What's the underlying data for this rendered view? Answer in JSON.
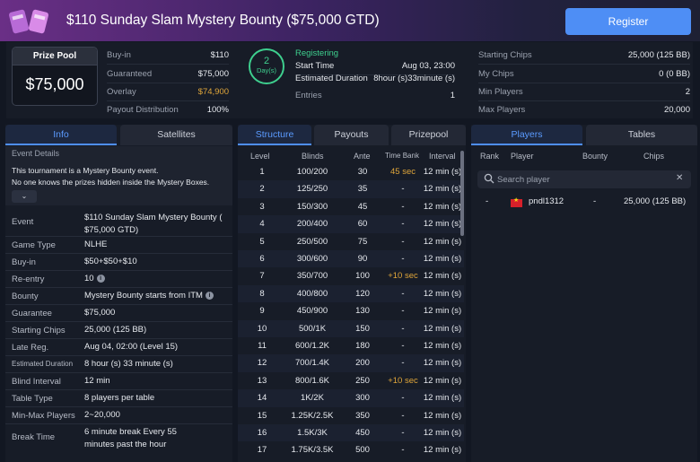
{
  "header": {
    "title": "$110 Sunday Slam Mystery Bounty ($75,000 GTD)",
    "register_label": "Register"
  },
  "summary": {
    "prize_pool_label": "Prize Pool",
    "prize_pool_value": "$75,000",
    "left": [
      {
        "label": "Buy-in",
        "value": "$110"
      },
      {
        "label": "Guaranteed",
        "value": "$75,000"
      },
      {
        "label": "Overlay",
        "value": "$74,900"
      },
      {
        "label": "Payout Distribution",
        "value": "100%"
      }
    ],
    "days_number": "2",
    "days_unit": "Day(s)",
    "status": "Registering",
    "middle": [
      {
        "label": "Start Time",
        "value": "Aug 03, 23:00"
      },
      {
        "label": "Estimated Duration",
        "value": "8hour (s)33minute (s)"
      },
      {
        "label": "Entries",
        "value": "1"
      }
    ],
    "right": [
      {
        "label": "Starting Chips",
        "value": "25,000 (125 BB)"
      },
      {
        "label": "My Chips",
        "value": "0 (0 BB)"
      },
      {
        "label": "Min Players",
        "value": "2"
      },
      {
        "label": "Max Players",
        "value": "20,000"
      }
    ]
  },
  "info_panel": {
    "tabs": [
      "Info",
      "Satellites"
    ],
    "event_details_title": "Event Details",
    "event_details_text": [
      "This tournament is a Mystery Bounty event.",
      "No one knows the prizes hidden inside the Mystery Boxes."
    ],
    "rows": [
      {
        "label": "Event",
        "value": "$110 Sunday Slam Mystery Bounty ( $75,000 GTD)"
      },
      {
        "label": "Game Type",
        "value": "NLHE"
      },
      {
        "label": "Buy-in",
        "value": "$50+$50+$10"
      },
      {
        "label": "Re-entry",
        "value": "10"
      },
      {
        "label": "Bounty",
        "value": "Mystery Bounty starts from ITM"
      },
      {
        "label": "Guarantee",
        "value": "$75,000"
      },
      {
        "label": "Starting Chips",
        "value": "25,000 (125 BB)"
      },
      {
        "label": "Late Reg.",
        "value": "Aug 04, 02:00 (Level 15)"
      },
      {
        "label": "Estimated Duration",
        "value": "8 hour (s) 33 minute (s)"
      },
      {
        "label": "Blind Interval",
        "value": "12 min"
      },
      {
        "label": "Table Type",
        "value": "8 players per table"
      },
      {
        "label": "Min-Max Players",
        "value": "2~20,000"
      },
      {
        "label": "Break Time",
        "value": "6 minute break Every 55 minutes past the hour"
      }
    ]
  },
  "structure_panel": {
    "tabs": [
      "Structure",
      "Payouts",
      "Prizepool"
    ],
    "columns": [
      "Level",
      "Blinds",
      "Ante",
      "Time Bank",
      "Interval"
    ],
    "rows": [
      {
        "level": "1",
        "blinds": "100/200",
        "ante": "30",
        "time_bank": "45 sec",
        "interval": "12 min (s)"
      },
      {
        "level": "2",
        "blinds": "125/250",
        "ante": "35",
        "time_bank": "-",
        "interval": "12 min (s)"
      },
      {
        "level": "3",
        "blinds": "150/300",
        "ante": "45",
        "time_bank": "-",
        "interval": "12 min (s)"
      },
      {
        "level": "4",
        "blinds": "200/400",
        "ante": "60",
        "time_bank": "-",
        "interval": "12 min (s)"
      },
      {
        "level": "5",
        "blinds": "250/500",
        "ante": "75",
        "time_bank": "-",
        "interval": "12 min (s)"
      },
      {
        "level": "6",
        "blinds": "300/600",
        "ante": "90",
        "time_bank": "-",
        "interval": "12 min (s)"
      },
      {
        "level": "7",
        "blinds": "350/700",
        "ante": "100",
        "time_bank": "+10 sec",
        "interval": "12 min (s)"
      },
      {
        "level": "8",
        "blinds": "400/800",
        "ante": "120",
        "time_bank": "-",
        "interval": "12 min (s)"
      },
      {
        "level": "9",
        "blinds": "450/900",
        "ante": "130",
        "time_bank": "-",
        "interval": "12 min (s)"
      },
      {
        "level": "10",
        "blinds": "500/1K",
        "ante": "150",
        "time_bank": "-",
        "interval": "12 min (s)"
      },
      {
        "level": "11",
        "blinds": "600/1.2K",
        "ante": "180",
        "time_bank": "-",
        "interval": "12 min (s)"
      },
      {
        "level": "12",
        "blinds": "700/1.4K",
        "ante": "200",
        "time_bank": "-",
        "interval": "12 min (s)"
      },
      {
        "level": "13",
        "blinds": "800/1.6K",
        "ante": "250",
        "time_bank": "+10 sec",
        "interval": "12 min (s)"
      },
      {
        "level": "14",
        "blinds": "1K/2K",
        "ante": "300",
        "time_bank": "-",
        "interval": "12 min (s)"
      },
      {
        "level": "15",
        "blinds": "1.25K/2.5K",
        "ante": "350",
        "time_bank": "-",
        "interval": "12 min (s)"
      },
      {
        "level": "16",
        "blinds": "1.5K/3K",
        "ante": "450",
        "time_bank": "-",
        "interval": "12 min (s)"
      },
      {
        "level": "17",
        "blinds": "1.75K/3.5K",
        "ante": "500",
        "time_bank": "-",
        "interval": "12 min (s)"
      }
    ]
  },
  "players_panel": {
    "tabs": [
      "Players",
      "Tables"
    ],
    "columns": [
      "Rank",
      "Player",
      "Bounty",
      "Chips"
    ],
    "search_placeholder": "Search player",
    "players": [
      {
        "rank": "-",
        "name": "pndl1312",
        "bounty": "-",
        "chips": "25,000 (125 BB)"
      }
    ]
  }
}
